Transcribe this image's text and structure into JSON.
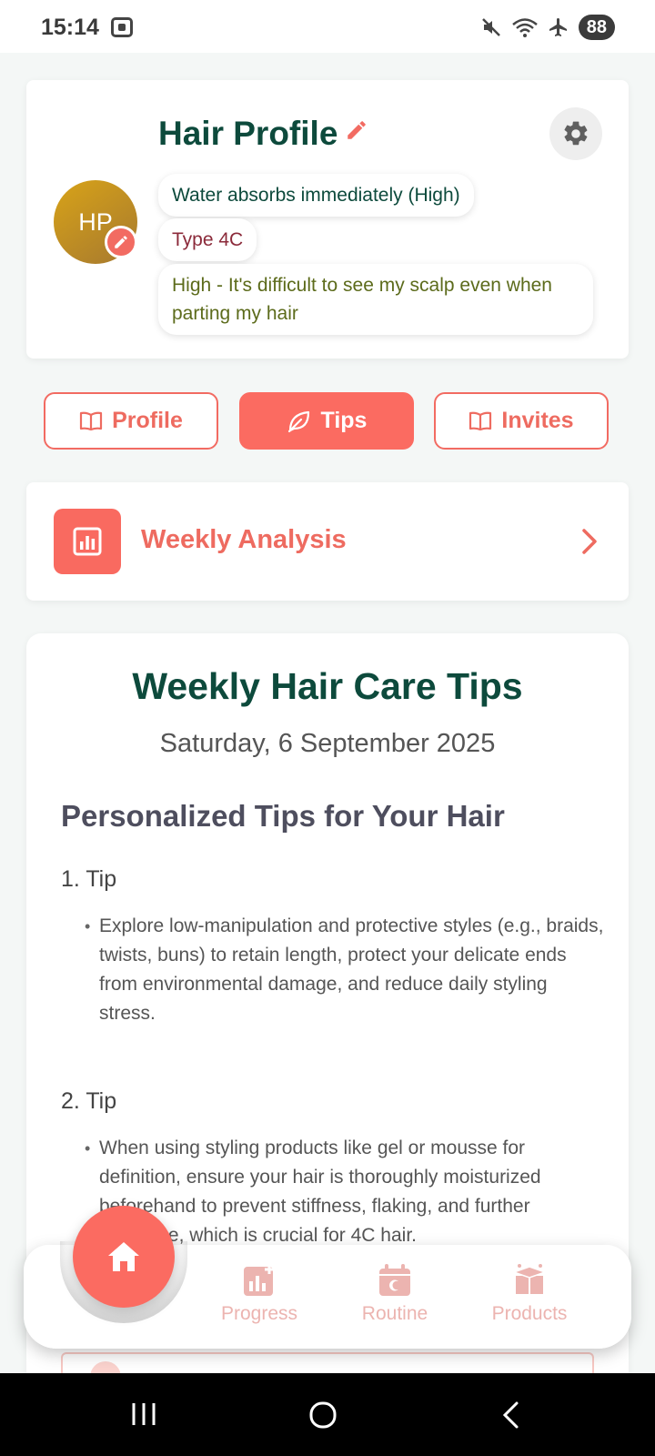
{
  "status_bar": {
    "time": "15:14",
    "battery": "88"
  },
  "profile": {
    "title": "Hair Profile",
    "avatar_initials": "HP",
    "porosity": "Water absorbs immediately (High)",
    "hair_type": "Type 4C",
    "density": "High - It's difficult to see my scalp even when parting my hair"
  },
  "tabs": [
    {
      "label": "Profile",
      "icon": "book-icon",
      "active": false
    },
    {
      "label": "Tips",
      "icon": "leaf-icon",
      "active": true
    },
    {
      "label": "Invites",
      "icon": "book-icon",
      "active": false
    }
  ],
  "weekly_analysis": {
    "label": "Weekly Analysis",
    "icon": "bar-chart-icon"
  },
  "tips_card": {
    "title": "Weekly Hair Care Tips",
    "date": "Saturday, 6 September 2025",
    "subtitle": "Personalized Tips for Your Hair",
    "tips": [
      {
        "heading": "1. Tip",
        "body": "Explore low-manipulation and protective styles (e.g., braids, twists, buns) to retain length, protect your delicate ends from environmental damage, and reduce daily styling stress."
      },
      {
        "heading": "2. Tip",
        "body": "When using styling products like gel or mousse for definition, ensure your hair is thoroughly moisturized beforehand to prevent stiffness, flaking, and further breakage, which is crucial for 4C hair."
      }
    ]
  },
  "bottom_nav": {
    "items": [
      {
        "label": "Progress",
        "icon": "progress-chart-icon"
      },
      {
        "label": "Routine",
        "icon": "calendar-icon"
      },
      {
        "label": "Products",
        "icon": "box-icon"
      }
    ],
    "home_icon": "home-icon"
  },
  "colors": {
    "accent": "#fb6b61",
    "primary_text": "#0d4a3c",
    "nav_inactive": "#ecb4b0"
  }
}
